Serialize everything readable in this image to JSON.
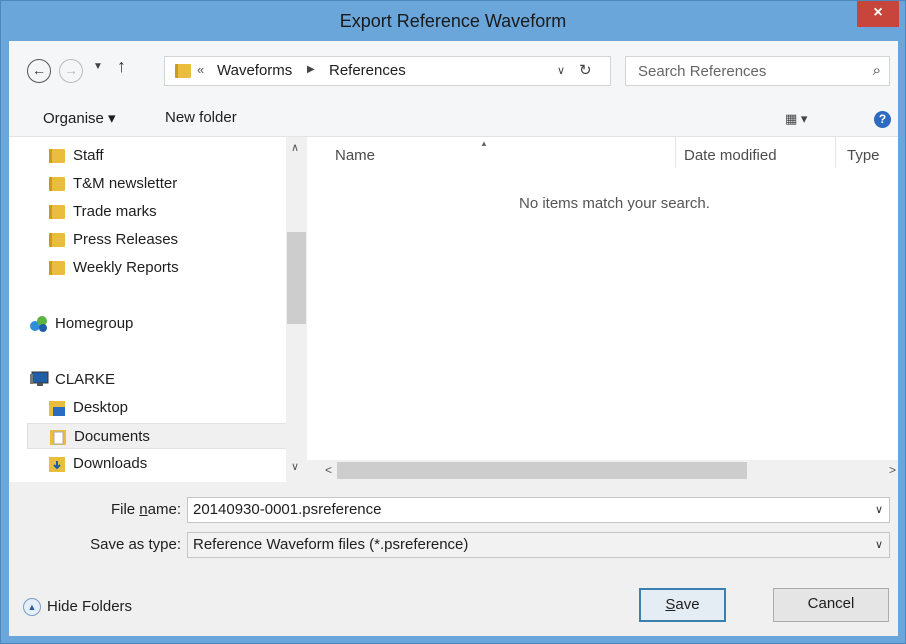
{
  "window": {
    "title": "Export Reference Waveform",
    "close_glyph": "×"
  },
  "navbar": {
    "back_icon": "back-arrow-icon",
    "forward_icon": "forward-arrow-icon",
    "breadcrumb_sep": "«",
    "crumbs": [
      "Waveforms",
      "References"
    ],
    "crumb_arrow": "▶",
    "search_placeholder": "Search References"
  },
  "toolbar": {
    "organise": "Organise ▾",
    "new_folder": "New folder",
    "views": "▦ ▾",
    "help": "?"
  },
  "nav": {
    "items": [
      "Staff",
      "T&M newsletter",
      "Trade marks",
      "Press Releases",
      "Weekly Reports"
    ],
    "homegroup": "Homegroup",
    "computer": "CLARKE",
    "computer_items": [
      "Desktop",
      "Documents",
      "Downloads"
    ]
  },
  "content": {
    "columns": [
      "Name",
      "Date modified",
      "Type"
    ],
    "empty_message": "No items match your search."
  },
  "form": {
    "file_name_label_pre": "File ",
    "file_name_label_u": "n",
    "file_name_label_post": "ame:",
    "file_name_value": "20140930-0001.psreference",
    "save_type_label": "Save as type:",
    "save_type_value": "Reference Waveform files (*.psreference)"
  },
  "footer": {
    "hide_folders": "Hide Folders",
    "save_u": "S",
    "save_rest": "ave",
    "cancel": "Cancel"
  },
  "colors": {
    "titlebar": "#6aa6da",
    "close": "#c7453a",
    "folder": "#e9be3e"
  }
}
